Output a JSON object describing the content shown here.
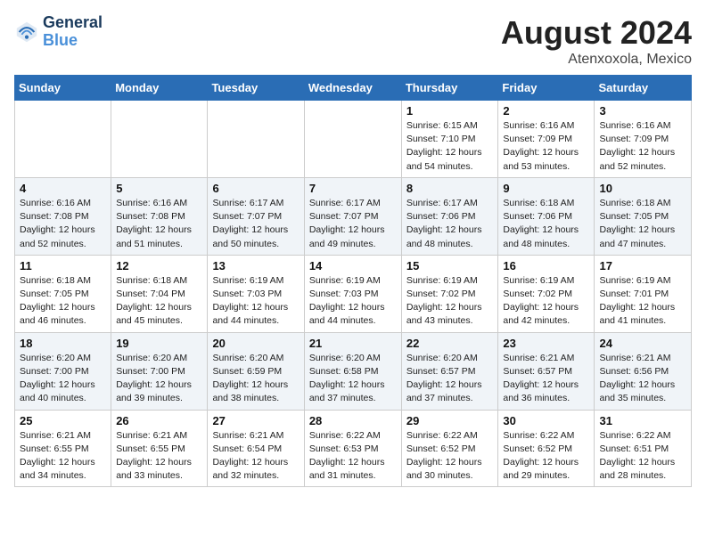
{
  "header": {
    "logo_line1": "General",
    "logo_line2": "Blue",
    "month_title": "August 2024",
    "location": "Atenxoxola, Mexico"
  },
  "weekdays": [
    "Sunday",
    "Monday",
    "Tuesday",
    "Wednesday",
    "Thursday",
    "Friday",
    "Saturday"
  ],
  "weeks": [
    [
      {
        "day": "",
        "info": ""
      },
      {
        "day": "",
        "info": ""
      },
      {
        "day": "",
        "info": ""
      },
      {
        "day": "",
        "info": ""
      },
      {
        "day": "1",
        "info": "Sunrise: 6:15 AM\nSunset: 7:10 PM\nDaylight: 12 hours\nand 54 minutes."
      },
      {
        "day": "2",
        "info": "Sunrise: 6:16 AM\nSunset: 7:09 PM\nDaylight: 12 hours\nand 53 minutes."
      },
      {
        "day": "3",
        "info": "Sunrise: 6:16 AM\nSunset: 7:09 PM\nDaylight: 12 hours\nand 52 minutes."
      }
    ],
    [
      {
        "day": "4",
        "info": "Sunrise: 6:16 AM\nSunset: 7:08 PM\nDaylight: 12 hours\nand 52 minutes."
      },
      {
        "day": "5",
        "info": "Sunrise: 6:16 AM\nSunset: 7:08 PM\nDaylight: 12 hours\nand 51 minutes."
      },
      {
        "day": "6",
        "info": "Sunrise: 6:17 AM\nSunset: 7:07 PM\nDaylight: 12 hours\nand 50 minutes."
      },
      {
        "day": "7",
        "info": "Sunrise: 6:17 AM\nSunset: 7:07 PM\nDaylight: 12 hours\nand 49 minutes."
      },
      {
        "day": "8",
        "info": "Sunrise: 6:17 AM\nSunset: 7:06 PM\nDaylight: 12 hours\nand 48 minutes."
      },
      {
        "day": "9",
        "info": "Sunrise: 6:18 AM\nSunset: 7:06 PM\nDaylight: 12 hours\nand 48 minutes."
      },
      {
        "day": "10",
        "info": "Sunrise: 6:18 AM\nSunset: 7:05 PM\nDaylight: 12 hours\nand 47 minutes."
      }
    ],
    [
      {
        "day": "11",
        "info": "Sunrise: 6:18 AM\nSunset: 7:05 PM\nDaylight: 12 hours\nand 46 minutes."
      },
      {
        "day": "12",
        "info": "Sunrise: 6:18 AM\nSunset: 7:04 PM\nDaylight: 12 hours\nand 45 minutes."
      },
      {
        "day": "13",
        "info": "Sunrise: 6:19 AM\nSunset: 7:03 PM\nDaylight: 12 hours\nand 44 minutes."
      },
      {
        "day": "14",
        "info": "Sunrise: 6:19 AM\nSunset: 7:03 PM\nDaylight: 12 hours\nand 44 minutes."
      },
      {
        "day": "15",
        "info": "Sunrise: 6:19 AM\nSunset: 7:02 PM\nDaylight: 12 hours\nand 43 minutes."
      },
      {
        "day": "16",
        "info": "Sunrise: 6:19 AM\nSunset: 7:02 PM\nDaylight: 12 hours\nand 42 minutes."
      },
      {
        "day": "17",
        "info": "Sunrise: 6:19 AM\nSunset: 7:01 PM\nDaylight: 12 hours\nand 41 minutes."
      }
    ],
    [
      {
        "day": "18",
        "info": "Sunrise: 6:20 AM\nSunset: 7:00 PM\nDaylight: 12 hours\nand 40 minutes."
      },
      {
        "day": "19",
        "info": "Sunrise: 6:20 AM\nSunset: 7:00 PM\nDaylight: 12 hours\nand 39 minutes."
      },
      {
        "day": "20",
        "info": "Sunrise: 6:20 AM\nSunset: 6:59 PM\nDaylight: 12 hours\nand 38 minutes."
      },
      {
        "day": "21",
        "info": "Sunrise: 6:20 AM\nSunset: 6:58 PM\nDaylight: 12 hours\nand 37 minutes."
      },
      {
        "day": "22",
        "info": "Sunrise: 6:20 AM\nSunset: 6:57 PM\nDaylight: 12 hours\nand 37 minutes."
      },
      {
        "day": "23",
        "info": "Sunrise: 6:21 AM\nSunset: 6:57 PM\nDaylight: 12 hours\nand 36 minutes."
      },
      {
        "day": "24",
        "info": "Sunrise: 6:21 AM\nSunset: 6:56 PM\nDaylight: 12 hours\nand 35 minutes."
      }
    ],
    [
      {
        "day": "25",
        "info": "Sunrise: 6:21 AM\nSunset: 6:55 PM\nDaylight: 12 hours\nand 34 minutes."
      },
      {
        "day": "26",
        "info": "Sunrise: 6:21 AM\nSunset: 6:55 PM\nDaylight: 12 hours\nand 33 minutes."
      },
      {
        "day": "27",
        "info": "Sunrise: 6:21 AM\nSunset: 6:54 PM\nDaylight: 12 hours\nand 32 minutes."
      },
      {
        "day": "28",
        "info": "Sunrise: 6:22 AM\nSunset: 6:53 PM\nDaylight: 12 hours\nand 31 minutes."
      },
      {
        "day": "29",
        "info": "Sunrise: 6:22 AM\nSunset: 6:52 PM\nDaylight: 12 hours\nand 30 minutes."
      },
      {
        "day": "30",
        "info": "Sunrise: 6:22 AM\nSunset: 6:52 PM\nDaylight: 12 hours\nand 29 minutes."
      },
      {
        "day": "31",
        "info": "Sunrise: 6:22 AM\nSunset: 6:51 PM\nDaylight: 12 hours\nand 28 minutes."
      }
    ]
  ]
}
